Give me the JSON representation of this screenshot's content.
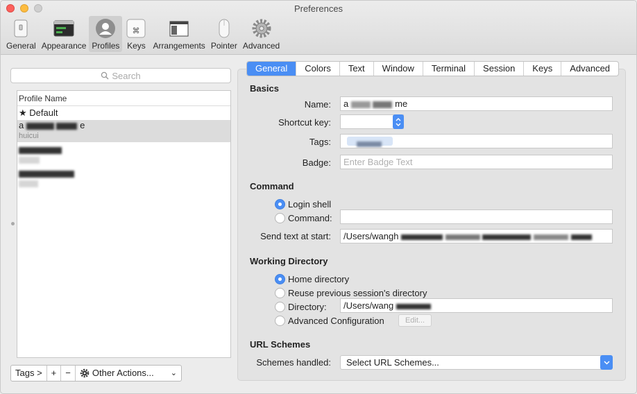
{
  "window": {
    "title": "Preferences"
  },
  "toolbar": {
    "items": [
      {
        "label": "General",
        "icon": "general-icon"
      },
      {
        "label": "Appearance",
        "icon": "appearance-icon"
      },
      {
        "label": "Profiles",
        "icon": "profiles-icon",
        "active": true
      },
      {
        "label": "Keys",
        "icon": "keys-icon"
      },
      {
        "label": "Arrangements",
        "icon": "arrangements-icon"
      },
      {
        "label": "Pointer",
        "icon": "pointer-icon"
      },
      {
        "label": "Advanced",
        "icon": "advanced-icon"
      }
    ]
  },
  "sidebar": {
    "search_placeholder": "Search",
    "list_header": "Profile Name",
    "default_profile": "★ Default",
    "profiles": [
      {
        "name_prefix": "a",
        "name_suffix": "e",
        "tag": "huicui",
        "selected": true
      }
    ]
  },
  "bottom_bar": {
    "tags_label": "Tags >",
    "add_label": "+",
    "remove_label": "−",
    "other_actions_label": "Other Actions..."
  },
  "tabs": [
    "General",
    "Colors",
    "Text",
    "Window",
    "Terminal",
    "Session",
    "Keys",
    "Advanced"
  ],
  "basics": {
    "title": "Basics",
    "name_label": "Name:",
    "name_value_prefix": "a",
    "name_value_suffix": "me",
    "shortcut_label": "Shortcut key:",
    "tags_label": "Tags:",
    "badge_label": "Badge:",
    "badge_placeholder": "Enter Badge Text"
  },
  "command": {
    "title": "Command",
    "login_shell_label": "Login shell",
    "command_label": "Command:",
    "send_text_label": "Send text at start:",
    "send_text_value_prefix": "/Users/wangh"
  },
  "working_directory": {
    "title": "Working Directory",
    "home_label": "Home directory",
    "reuse_label": "Reuse previous session's directory",
    "directory_label": "Directory:",
    "directory_value_prefix": "/Users/wang",
    "advanced_label": "Advanced Configuration",
    "edit_label": "Edit..."
  },
  "url_schemes": {
    "title": "URL Schemes",
    "schemes_label": "Schemes handled:",
    "schemes_value": "Select URL Schemes..."
  },
  "colors": {
    "accent": "#4a8ef4",
    "selected_row": "#dcdcdc"
  }
}
